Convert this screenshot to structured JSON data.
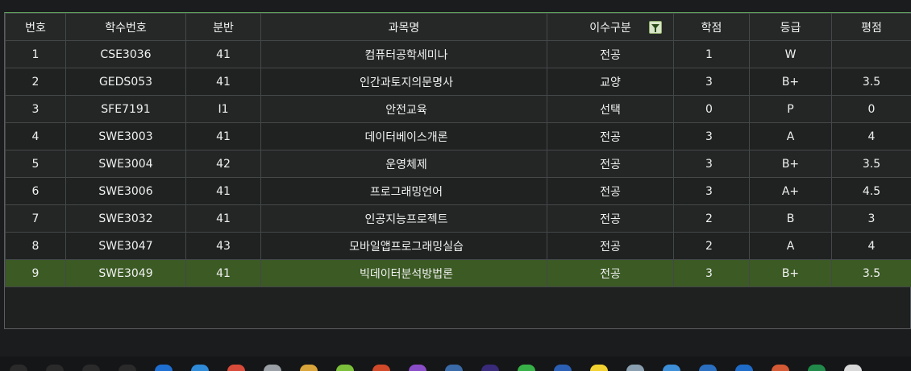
{
  "table": {
    "headers": [
      "번호",
      "학수번호",
      "분반",
      "과목명",
      "이수구분",
      "학점",
      "등급",
      "평점"
    ],
    "rows": [
      {
        "no": "1",
        "code": "CSE3036",
        "section": "41",
        "name": "컴퓨터공학세미나",
        "type": "전공",
        "credit": "1",
        "grade": "W",
        "point": ""
      },
      {
        "no": "2",
        "code": "GEDS053",
        "section": "41",
        "name": "인간과토지의문명사",
        "type": "교양",
        "credit": "3",
        "grade": "B+",
        "point": "3.5"
      },
      {
        "no": "3",
        "code": "SFE7191",
        "section": "I1",
        "name": "안전교육",
        "type": "선택",
        "credit": "0",
        "grade": "P",
        "point": "0"
      },
      {
        "no": "4",
        "code": "SWE3003",
        "section": "41",
        "name": "데이터베이스개론",
        "type": "전공",
        "credit": "3",
        "grade": "A",
        "point": "4"
      },
      {
        "no": "5",
        "code": "SWE3004",
        "section": "42",
        "name": "운영체제",
        "type": "전공",
        "credit": "3",
        "grade": "B+",
        "point": "3.5"
      },
      {
        "no": "6",
        "code": "SWE3006",
        "section": "41",
        "name": "프로그래밍언어",
        "type": "전공",
        "credit": "3",
        "grade": "A+",
        "point": "4.5"
      },
      {
        "no": "7",
        "code": "SWE3032",
        "section": "41",
        "name": "인공지능프로젝트",
        "type": "전공",
        "credit": "2",
        "grade": "B",
        "point": "3"
      },
      {
        "no": "8",
        "code": "SWE3047",
        "section": "43",
        "name": "모바일앱프로그래밍실습",
        "type": "전공",
        "credit": "2",
        "grade": "A",
        "point": "4"
      },
      {
        "no": "9",
        "code": "SWE3049",
        "section": "41",
        "name": "빅데이터분석방법론",
        "type": "전공",
        "credit": "3",
        "grade": "B+",
        "point": "3.5"
      }
    ],
    "selected_row": 8
  },
  "colors": {
    "selected_row": "#3b5a24",
    "header_bg": "#262828",
    "border": "#454849"
  },
  "taskbar": {
    "icons": [
      "start-icon",
      "search-icon",
      "task-view-icon",
      "settings-icon",
      "edge-icon",
      "ie-icon",
      "chrome-icon",
      "storage-icon",
      "folder-icon",
      "android-icon",
      "office-icon",
      "visual-studio-icon",
      "virtualbox-icon",
      "eclipse-icon",
      "green-app-icon",
      "word-icon",
      "kakaotalk-icon",
      "notepad-icon",
      "network-icon",
      "calendar-icon",
      "outlook-icon",
      "powerpoint-icon",
      "excel-icon",
      "document-icon"
    ]
  }
}
